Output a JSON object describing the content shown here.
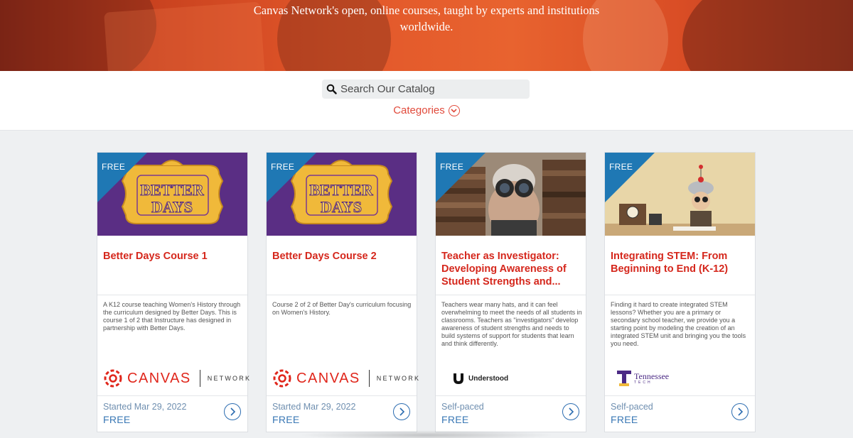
{
  "hero": {
    "tagline_line1": "Canvas Network's open, online courses, taught by experts and institutions",
    "tagline_line2": "worldwide."
  },
  "search": {
    "placeholder": "Search Our Catalog",
    "icon": "search-icon"
  },
  "categories": {
    "label": "Categories",
    "icon": "chevron-down-circle-icon"
  },
  "colors": {
    "accent_red": "#d5271c",
    "link_blue": "#2b6cb0",
    "free_badge": "#1f78b4"
  },
  "courses": [
    {
      "badge": "FREE",
      "title": "Better Days Course 1",
      "description": "A K12 course teaching Women's History through the curriculum designed by Better Days. This is course 1 of 2 that Instructure has designed in partnership with Better Days.",
      "logo_name": "CANVAS",
      "logo_sub": "NETWORK",
      "start": "Started Mar 29, 2022",
      "price": "FREE"
    },
    {
      "badge": "FREE",
      "title": "Better Days Course 2",
      "description": "Course 2 of 2 of Better Day's curriculum focusing on Women's History.",
      "logo_name": "CANVAS",
      "logo_sub": "NETWORK",
      "start": "Started Mar 29, 2022",
      "price": "FREE"
    },
    {
      "badge": "FREE",
      "title": "Teacher as Investigator: Developing Awareness of Student Strengths and...",
      "description": "Teachers wear many hats, and it can feel overwhelming to meet the needs of all students in classrooms. Teachers as \"investigators\" develop awareness of student strengths and needs to build systems of support for students that learn and think differently.",
      "logo_name": "Understood",
      "start": "Self-paced",
      "price": "FREE"
    },
    {
      "badge": "FREE",
      "title": "Integrating STEM: From Beginning to End (K-12)",
      "description": "Finding it hard to create integrated STEM lessons? Whether you are a primary or secondary school teacher, we provide you a starting point by modeling the creation of an integrated STEM unit and bringing you the tools you need.",
      "logo_name": "Tennessee",
      "logo_sub": "TECH",
      "start": "Self-paced",
      "price": "FREE"
    }
  ]
}
